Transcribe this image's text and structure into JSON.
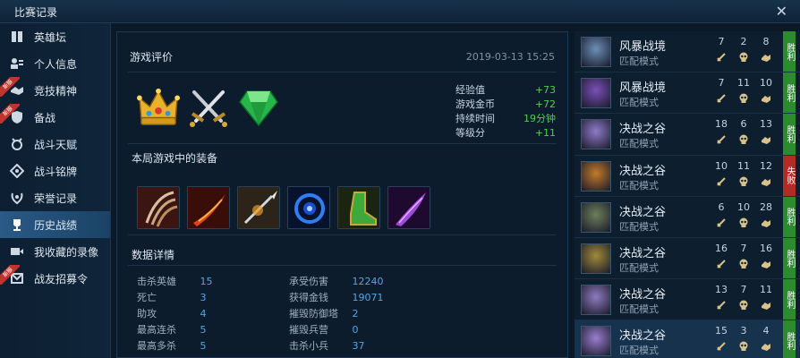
{
  "window": {
    "title": "比赛记录",
    "close_label": "✕"
  },
  "sidebar": {
    "items": [
      {
        "label": "英雄坛",
        "icon": "book-icon",
        "ribbon": ""
      },
      {
        "label": "个人信息",
        "icon": "profile-icon",
        "ribbon": ""
      },
      {
        "label": "竞技精神",
        "icon": "handshake-icon",
        "ribbon": "新服"
      },
      {
        "label": "备战",
        "icon": "shield-icon",
        "ribbon": "新服"
      },
      {
        "label": "战斗天赋",
        "icon": "talent-icon",
        "ribbon": ""
      },
      {
        "label": "战斗铭牌",
        "icon": "emblem-icon",
        "ribbon": ""
      },
      {
        "label": "荣誉记录",
        "icon": "laurel-icon",
        "ribbon": ""
      },
      {
        "label": "历史战绩",
        "icon": "trophy-icon",
        "ribbon": ""
      },
      {
        "label": "我收藏的录像",
        "icon": "video-icon",
        "ribbon": ""
      },
      {
        "label": "战友招募令",
        "icon": "recruit-icon",
        "ribbon": "新服"
      }
    ],
    "active_index": 7
  },
  "evaluation": {
    "title": "游戏评价",
    "date": "2019-03-13 15:25",
    "badges": [
      "crown-icon",
      "crossed-swords-icon",
      "emerald-icon"
    ],
    "stats": [
      {
        "label": "经验值",
        "value": "+73"
      },
      {
        "label": "游戏金币",
        "value": "+72"
      },
      {
        "label": "持续时间",
        "value": "19分钟"
      },
      {
        "label": "等级分",
        "value": "+11"
      }
    ]
  },
  "equipment": {
    "title": "本局游戏中的装备",
    "items": [
      "claw-item-icon",
      "flame-blade-item-icon",
      "spear-item-icon",
      "blue-orb-item-icon",
      "green-boots-item-icon",
      "purple-dagger-item-icon"
    ]
  },
  "details": {
    "title": "数据详情",
    "rows": [
      {
        "l1": "击杀英雄",
        "v1": "15",
        "l2": "承受伤害",
        "v2": "12240"
      },
      {
        "l1": "死亡",
        "v1": "3",
        "l2": "获得金钱",
        "v2": "19071"
      },
      {
        "l1": "助攻",
        "v1": "4",
        "l2": "摧毁防御塔",
        "v2": "2"
      },
      {
        "l1": "最高连杀",
        "v1": "5",
        "l2": "摧毁兵营",
        "v2": "0"
      },
      {
        "l1": "最高多杀",
        "v1": "5",
        "l2": "击杀小兵",
        "v2": "37"
      }
    ]
  },
  "matches": [
    {
      "map": "风暴战境",
      "mode": "匹配模式",
      "kills": "7",
      "deaths": "2",
      "assists": "8",
      "result": "胜利",
      "win": true,
      "avatar_color": "#6b8fb8"
    },
    {
      "map": "风暴战境",
      "mode": "匹配模式",
      "kills": "7",
      "deaths": "11",
      "assists": "10",
      "result": "胜利",
      "win": true,
      "avatar_color": "#7b4fb8"
    },
    {
      "map": "决战之谷",
      "mode": "匹配模式",
      "kills": "18",
      "deaths": "6",
      "assists": "13",
      "result": "胜利",
      "win": true,
      "avatar_color": "#8f7bc9"
    },
    {
      "map": "决战之谷",
      "mode": "匹配模式",
      "kills": "10",
      "deaths": "11",
      "assists": "12",
      "result": "失败",
      "win": false,
      "avatar_color": "#c27a2a"
    },
    {
      "map": "决战之谷",
      "mode": "匹配模式",
      "kills": "6",
      "deaths": "10",
      "assists": "28",
      "result": "胜利",
      "win": true,
      "avatar_color": "#6c7f5a"
    },
    {
      "map": "决战之谷",
      "mode": "匹配模式",
      "kills": "16",
      "deaths": "7",
      "assists": "16",
      "result": "胜利",
      "win": true,
      "avatar_color": "#a08a3a"
    },
    {
      "map": "决战之谷",
      "mode": "匹配模式",
      "kills": "13",
      "deaths": "7",
      "assists": "11",
      "result": "胜利",
      "win": true,
      "avatar_color": "#8e7bbf"
    },
    {
      "map": "决战之谷",
      "mode": "匹配模式",
      "kills": "15",
      "deaths": "3",
      "assists": "4",
      "result": "胜利",
      "win": true,
      "avatar_color": "#9a7ed0"
    }
  ],
  "colors": {
    "accent": "#2a5a86",
    "positive": "#4cd14c",
    "value_blue": "#4fa7e6",
    "win": "#2c8a2f",
    "lose": "#b12b27"
  }
}
